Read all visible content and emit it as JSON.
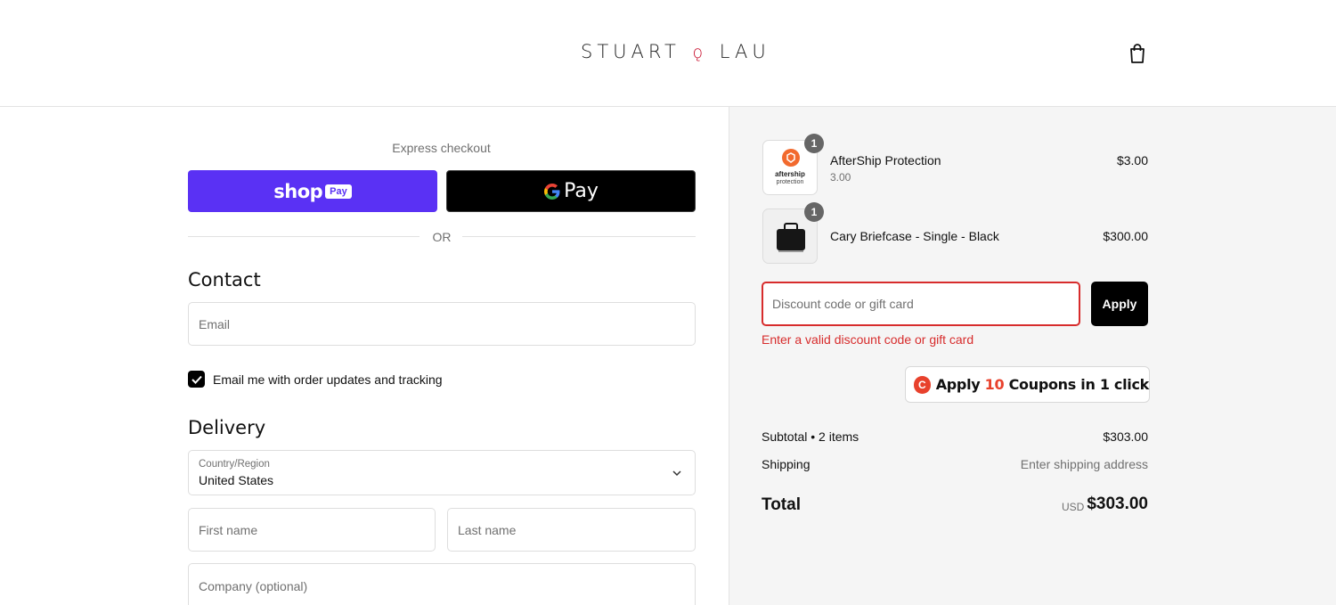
{
  "header": {
    "brand_left": "STUART",
    "brand_mark": "ǫ",
    "brand_right": "LAU",
    "cart_icon": "shopping-bag-icon"
  },
  "express": {
    "label": "Express checkout",
    "shoppay_text": "shop",
    "shoppay_badge": "Pay",
    "gpay_text": "Pay",
    "or_text": "OR",
    "shoppay_color": "#5a31f4"
  },
  "contact": {
    "title": "Contact",
    "email_placeholder": "Email",
    "newsletter_label": "Email me with order updates and tracking",
    "newsletter_checked": true
  },
  "delivery": {
    "title": "Delivery",
    "country_label": "Country/Region",
    "country_value": "United States",
    "first_name_placeholder": "First name",
    "last_name_placeholder": "Last name",
    "company_placeholder": "Company (optional)"
  },
  "summary": {
    "items": [
      {
        "name": "AfterShip Protection",
        "subtitle": "3.00",
        "price": "$3.00",
        "qty": "1",
        "thumb_text": "aftership",
        "thumb_subtext": "protection"
      },
      {
        "name": "Cary Briefcase - Single - Black",
        "price": "$300.00",
        "qty": "1"
      }
    ],
    "discount_placeholder": "Discount code or gift card",
    "apply_label": "Apply",
    "error_text": "Enter a valid discount code or gift card",
    "coupon": {
      "prefix": "Apply ",
      "count": "10",
      "suffix": " Coupons in 1 click",
      "logo_letter": "C"
    },
    "subtotal_label": "Subtotal • 2 items",
    "subtotal_value": "$303.00",
    "shipping_label": "Shipping",
    "shipping_value": "Enter shipping address",
    "total_label": "Total",
    "currency": "USD",
    "total_value": "$303.00",
    "error_color": "#d72c2c"
  }
}
